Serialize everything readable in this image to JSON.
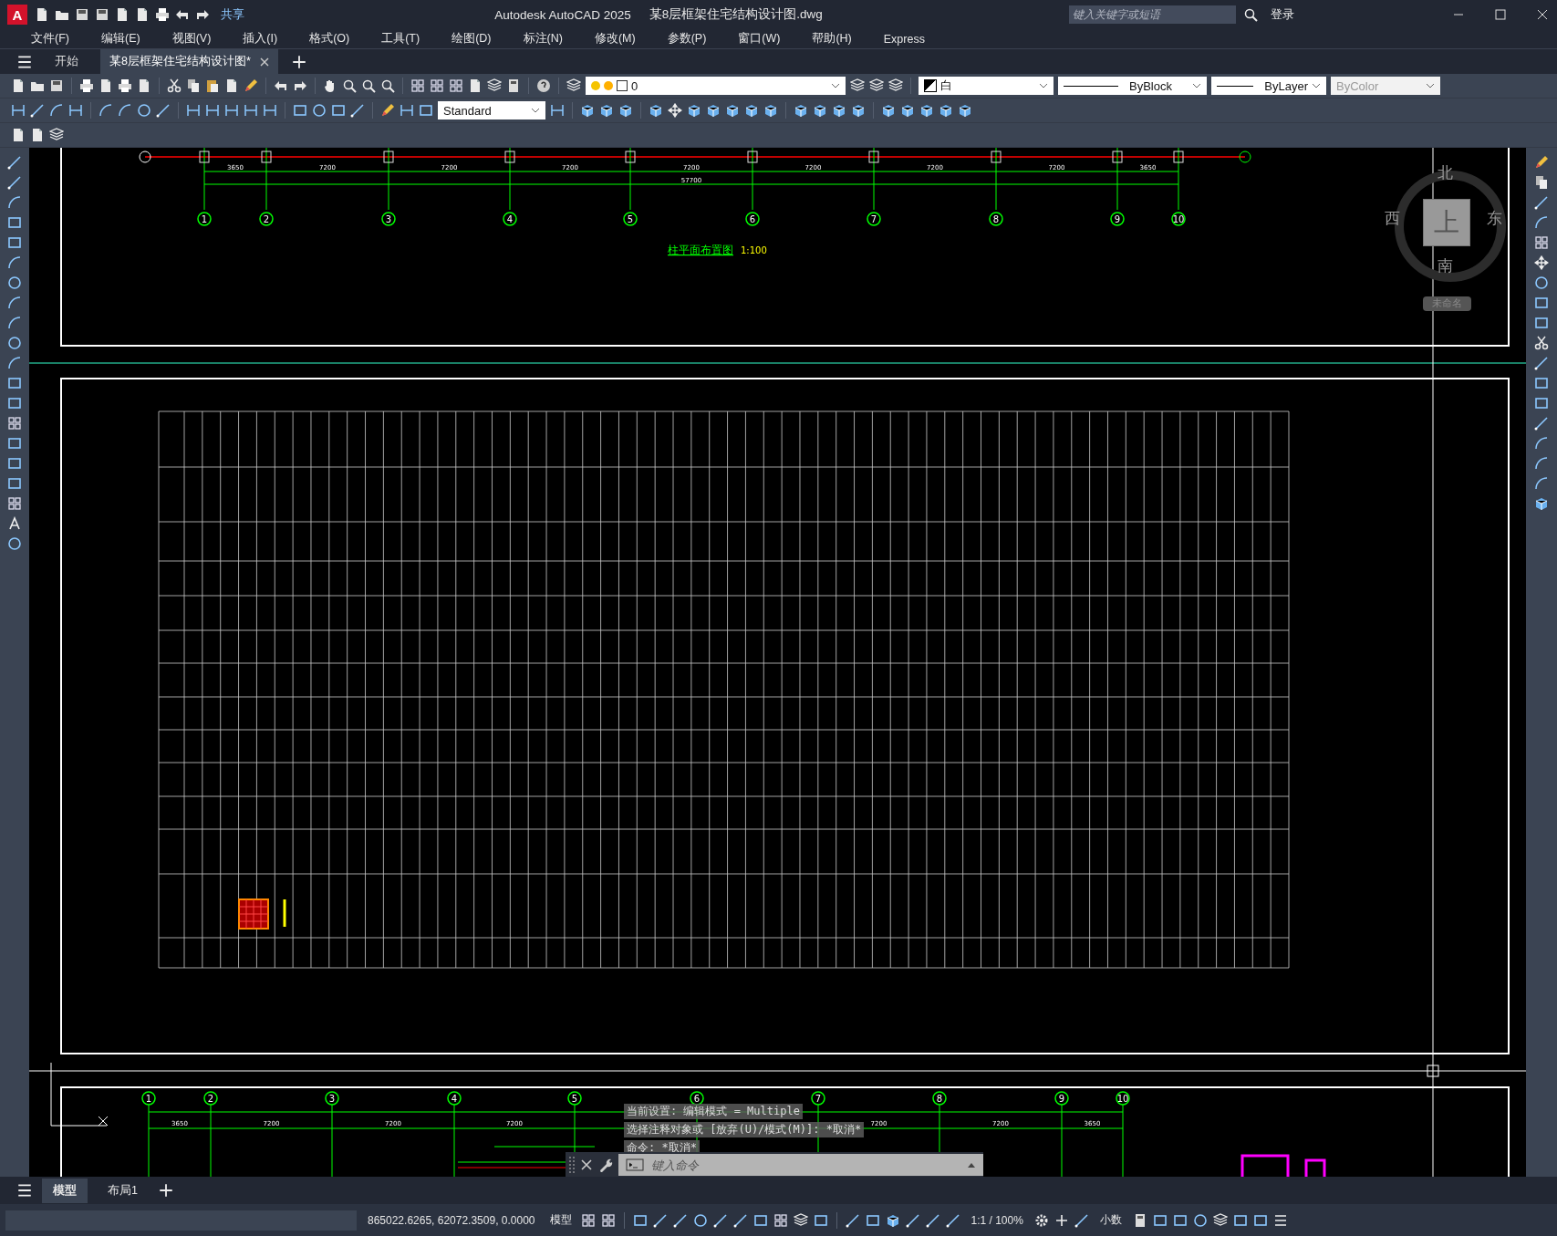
{
  "window": {
    "logo": "A",
    "app_title": "Autodesk AutoCAD 2025",
    "file_title": "某8层框架住宅结构设计图.dwg",
    "share": "共享",
    "search": {
      "placeholder": "键入关键字或短语"
    },
    "sign_in": "登录"
  },
  "menu": [
    "文件(F)",
    "编辑(E)",
    "视图(V)",
    "插入(I)",
    "格式(O)",
    "工具(T)",
    "绘图(D)",
    "标注(N)",
    "修改(M)",
    "参数(P)",
    "窗口(W)",
    "帮助(H)",
    "Express"
  ],
  "file_tabs": [
    {
      "label": "开始",
      "selected": false
    },
    {
      "label": "某8层框架住宅结构设计图*",
      "selected": true
    }
  ],
  "properties": {
    "layer": "0",
    "color_setting": "白",
    "linetype": "ByBlock",
    "lineweight": "ByLayer",
    "plot_style": {
      "value": "ByColor",
      "disabled": true
    },
    "text_style": "Standard"
  },
  "viewcube": {
    "north": "北",
    "south": "南",
    "east": "东",
    "west": "西",
    "face": "上",
    "view_name": "未命名"
  },
  "drawing": {
    "top_axes": [
      "1",
      "2",
      "3",
      "4",
      "5",
      "6",
      "7",
      "8",
      "9",
      "10"
    ],
    "top_dims": [
      "3650",
      "7200",
      "7200",
      "7200",
      "7200",
      "7200",
      "7200",
      "7200",
      "3650"
    ],
    "top_total": "57700",
    "plan_title": "柱平面布置图",
    "plan_scale": "1:100",
    "bottom_axes": [
      "1",
      "2",
      "3",
      "4",
      "5",
      "6",
      "7",
      "8",
      "9",
      "10"
    ],
    "bottom_dims": [
      "3650",
      "7200",
      "7200",
      "7200",
      "7200",
      "7200",
      "3650"
    ]
  },
  "command_line": {
    "history": [
      "当前设置: 编辑模式 = Multiple",
      "选择注释对象或 [放弃(U)/模式(M)]: *取消*",
      "命令: *取消*"
    ],
    "placeholder": "键入命令"
  },
  "layout_tabs": [
    {
      "label": "模型",
      "selected": true
    },
    {
      "label": "布局1",
      "selected": false
    }
  ],
  "status_bar": {
    "coordinates": "865022.6265, 62072.3509, 0.0000",
    "space": "模型",
    "scale": "1:1 / 100%",
    "units": "小数"
  }
}
